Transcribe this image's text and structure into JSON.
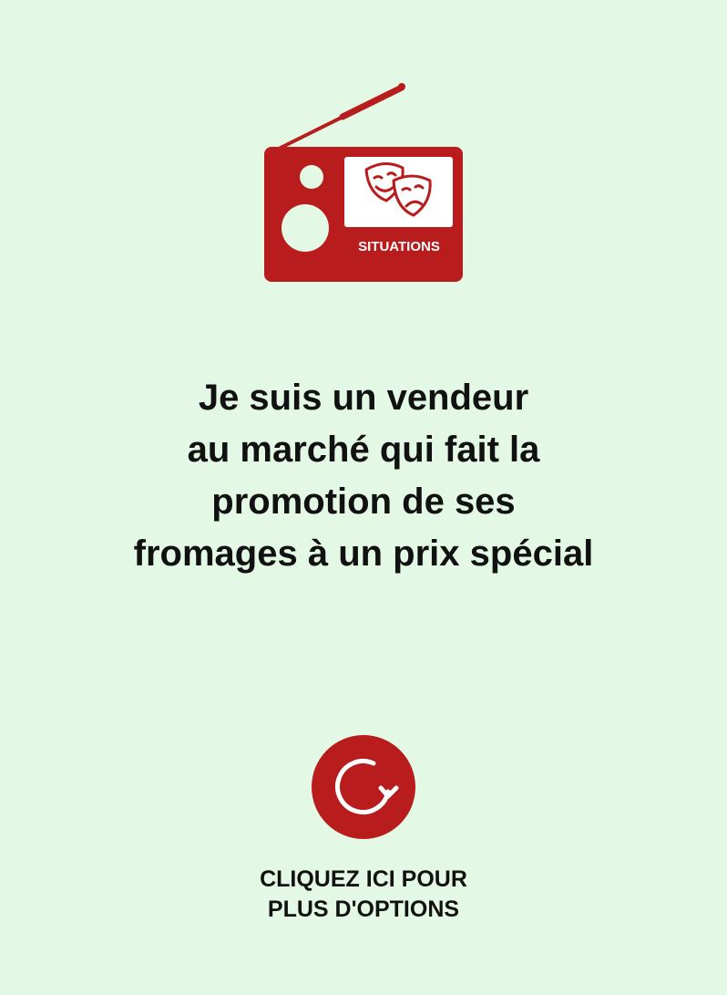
{
  "header": {
    "logo_icon": "radio-theatre-masks-icon",
    "logo_label": "SITUATIONS",
    "brand_color": "#b81c1c"
  },
  "situation": {
    "lines": [
      "Je suis un vendeur",
      "au marché qui fait la",
      "promotion de ses",
      "fromages à un prix spécial"
    ]
  },
  "options": {
    "icon": "refresh-icon",
    "lines": [
      "CLIQUEZ ICI POUR",
      "PLUS D'OPTIONS"
    ]
  },
  "colors": {
    "background": "#e3f9e5",
    "accent": "#b81c1c",
    "text": "#111111"
  }
}
